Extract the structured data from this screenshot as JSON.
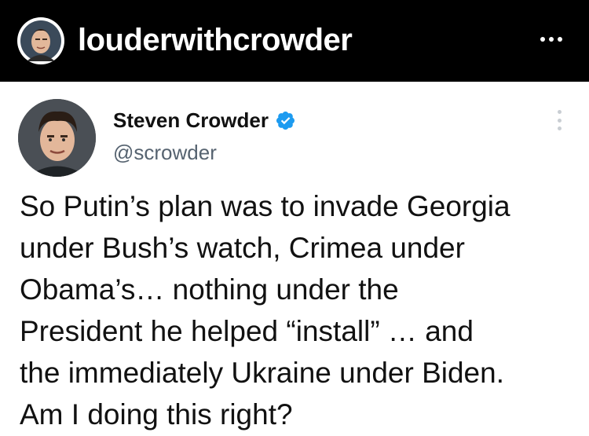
{
  "instagram": {
    "username": "louderwithcrowder",
    "avatar_icon": "profile-photo"
  },
  "tweet": {
    "author_name": "Steven Crowder",
    "handle": "@scrowder",
    "verified": true,
    "verified_color": "#1d9bf0",
    "text_lines": [
      "So Putin’s plan was to invade Georgia",
      "under Bush’s watch, Crimea under",
      "Obama’s… nothing under the",
      "President he helped “install” … and",
      "the immediately Ukraine under Biden.",
      "Am I doing this right?"
    ]
  }
}
